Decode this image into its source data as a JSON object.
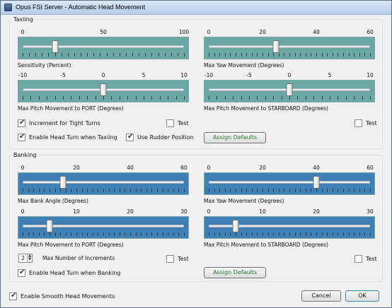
{
  "window": {
    "title": "Opus FSI Server - Automatic Head Movement"
  },
  "taxiing": {
    "legend": "Taxiing",
    "sliders": [
      {
        "label": "Sensitivity (Percent)",
        "ticks": [
          "0",
          "50",
          "100"
        ],
        "min": 0,
        "max": 100,
        "value": 20,
        "color": "#6aa7a5"
      },
      {
        "label": "Max Yaw Movement (Degrees)",
        "ticks": [
          "0",
          "20",
          "40",
          "60"
        ],
        "min": 0,
        "max": 60,
        "value": 25,
        "color": "#6aa7a5"
      },
      {
        "label": "Max Pitch Movement to PORT (Degrees)",
        "ticks": [
          "-10",
          "-5",
          "0",
          "5",
          "10"
        ],
        "min": -10,
        "max": 10,
        "value": 0,
        "color": "#6aa7a5"
      },
      {
        "label": "Max Pitch Movement to STARBOARD (Degrees)",
        "ticks": [
          "-10",
          "-5",
          "0",
          "5",
          "10"
        ],
        "min": -10,
        "max": 10,
        "value": 0,
        "color": "#6aa7a5"
      }
    ],
    "increment_label": "Increment for Tight Turns",
    "increment_checked": true,
    "test_port_label": "Test",
    "test_starboard_label": "Test",
    "head_turn_label": "Enable Head Turn when Taxiing",
    "head_turn_checked": true,
    "rudder_label": "Use Rudder Position",
    "rudder_checked": true,
    "assign_defaults": "Assign Defaults"
  },
  "banking": {
    "legend": "Banking",
    "sliders": [
      {
        "label": "Max Bank Angle (Degrees)",
        "ticks": [
          "0",
          "20",
          "40",
          "60"
        ],
        "min": 0,
        "max": 60,
        "value": 15,
        "color": "#3e7fb5"
      },
      {
        "label": "Max Yaw Movement (Degrees)",
        "ticks": [
          "0",
          "20",
          "40",
          "60"
        ],
        "min": 0,
        "max": 60,
        "value": 40,
        "color": "#3e7fb5"
      },
      {
        "label": "Max Pitch Movement to PORT (Degrees)",
        "ticks": [
          "0",
          "10",
          "20",
          "30"
        ],
        "min": 0,
        "max": 30,
        "value": 5,
        "color": "#3e7fb5"
      },
      {
        "label": "Max Pitch Movement to STARBOARD (Degrees)",
        "ticks": [
          "0",
          "10",
          "20",
          "30"
        ],
        "min": 0,
        "max": 30,
        "value": 5,
        "color": "#3e7fb5"
      }
    ],
    "increments_value": "2",
    "increments_label": "Max Number of Increments",
    "test_port_label": "Test",
    "test_starboard_label": "Test",
    "head_turn_label": "Enable Head Turn when Banking",
    "head_turn_checked": true,
    "assign_defaults": "Assign Defaults"
  },
  "footer": {
    "smooth_label": "Enable Smooth Head Movements",
    "smooth_checked": true,
    "cancel": "Cancel",
    "ok": "OK"
  }
}
